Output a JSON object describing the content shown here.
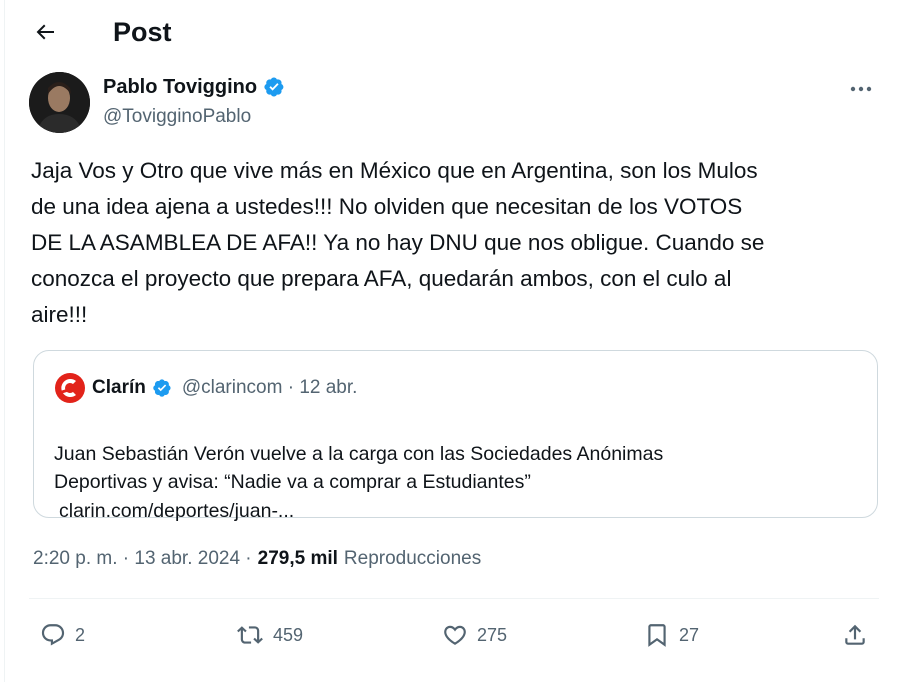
{
  "header": {
    "title": "Post",
    "back_icon": "arrow-left-icon"
  },
  "author": {
    "name": "Pablo Toviggino",
    "handle": "@TovigginoPablo",
    "verified": true,
    "verified_color": "#1d9bf0"
  },
  "post": {
    "text": "Jaja Vos y Otro que vive más en México que en Argentina, son los Mulos\nde una idea ajena a ustedes!!! No olviden que necesitan de los VOTOS\nDE LA ASAMBLEA DE AFA!! Ya no hay DNU que nos obligue. Cuando se\nconozca el proyecto que prepara AFA, quedarán ambos, con el culo al\naire!!!"
  },
  "quote": {
    "name": "Clarín",
    "handle_date": "@clarincom · 12 abr.",
    "text": "Juan Sebastián Verón vuelve a la carga con las Sociedades Anónimas\nDeportivas y avisa: “Nadie va a comprar a Estudiantes”",
    "link": "clarin.com/deportes/juan-...",
    "logo_color": "#e2231a"
  },
  "meta": {
    "time_date": "2:20 p. m. · 13 abr. 2024 ·",
    "views_count": "279,5 mil",
    "views_label": "Reproducciones"
  },
  "actions": {
    "replies": "2",
    "reposts": "459",
    "likes": "275",
    "bookmarks": "27"
  }
}
